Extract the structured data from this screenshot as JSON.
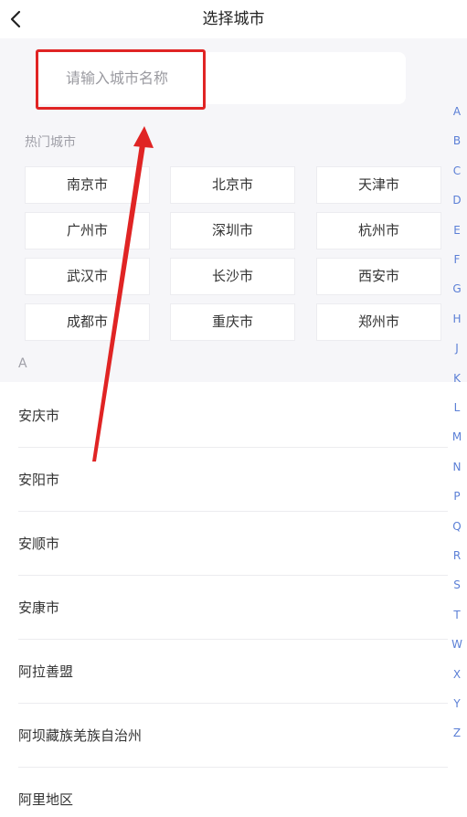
{
  "header": {
    "title": "选择城市",
    "back_icon": "chevron-left-icon"
  },
  "search": {
    "placeholder": "请输入城市名称",
    "value": ""
  },
  "hot": {
    "label": "热门城市",
    "cities": [
      "南京市",
      "北京市",
      "天津市",
      "广州市",
      "深圳市",
      "杭州市",
      "武汉市",
      "长沙市",
      "西安市",
      "成都市",
      "重庆市",
      "郑州市"
    ]
  },
  "section": {
    "letter": "A",
    "items": [
      "安庆市",
      "安阳市",
      "安顺市",
      "安康市",
      "阿拉善盟",
      "阿坝藏族羌族自治州",
      "阿里地区"
    ]
  },
  "index": [
    "A",
    "B",
    "C",
    "D",
    "E",
    "F",
    "G",
    "H",
    "J",
    "K",
    "L",
    "M",
    "N",
    "P",
    "Q",
    "R",
    "S",
    "T",
    "W",
    "X",
    "Y",
    "Z"
  ],
  "colors": {
    "annotation": "#e02424",
    "index_text": "#5b7fd6",
    "section_bg": "#f6f6f9"
  }
}
